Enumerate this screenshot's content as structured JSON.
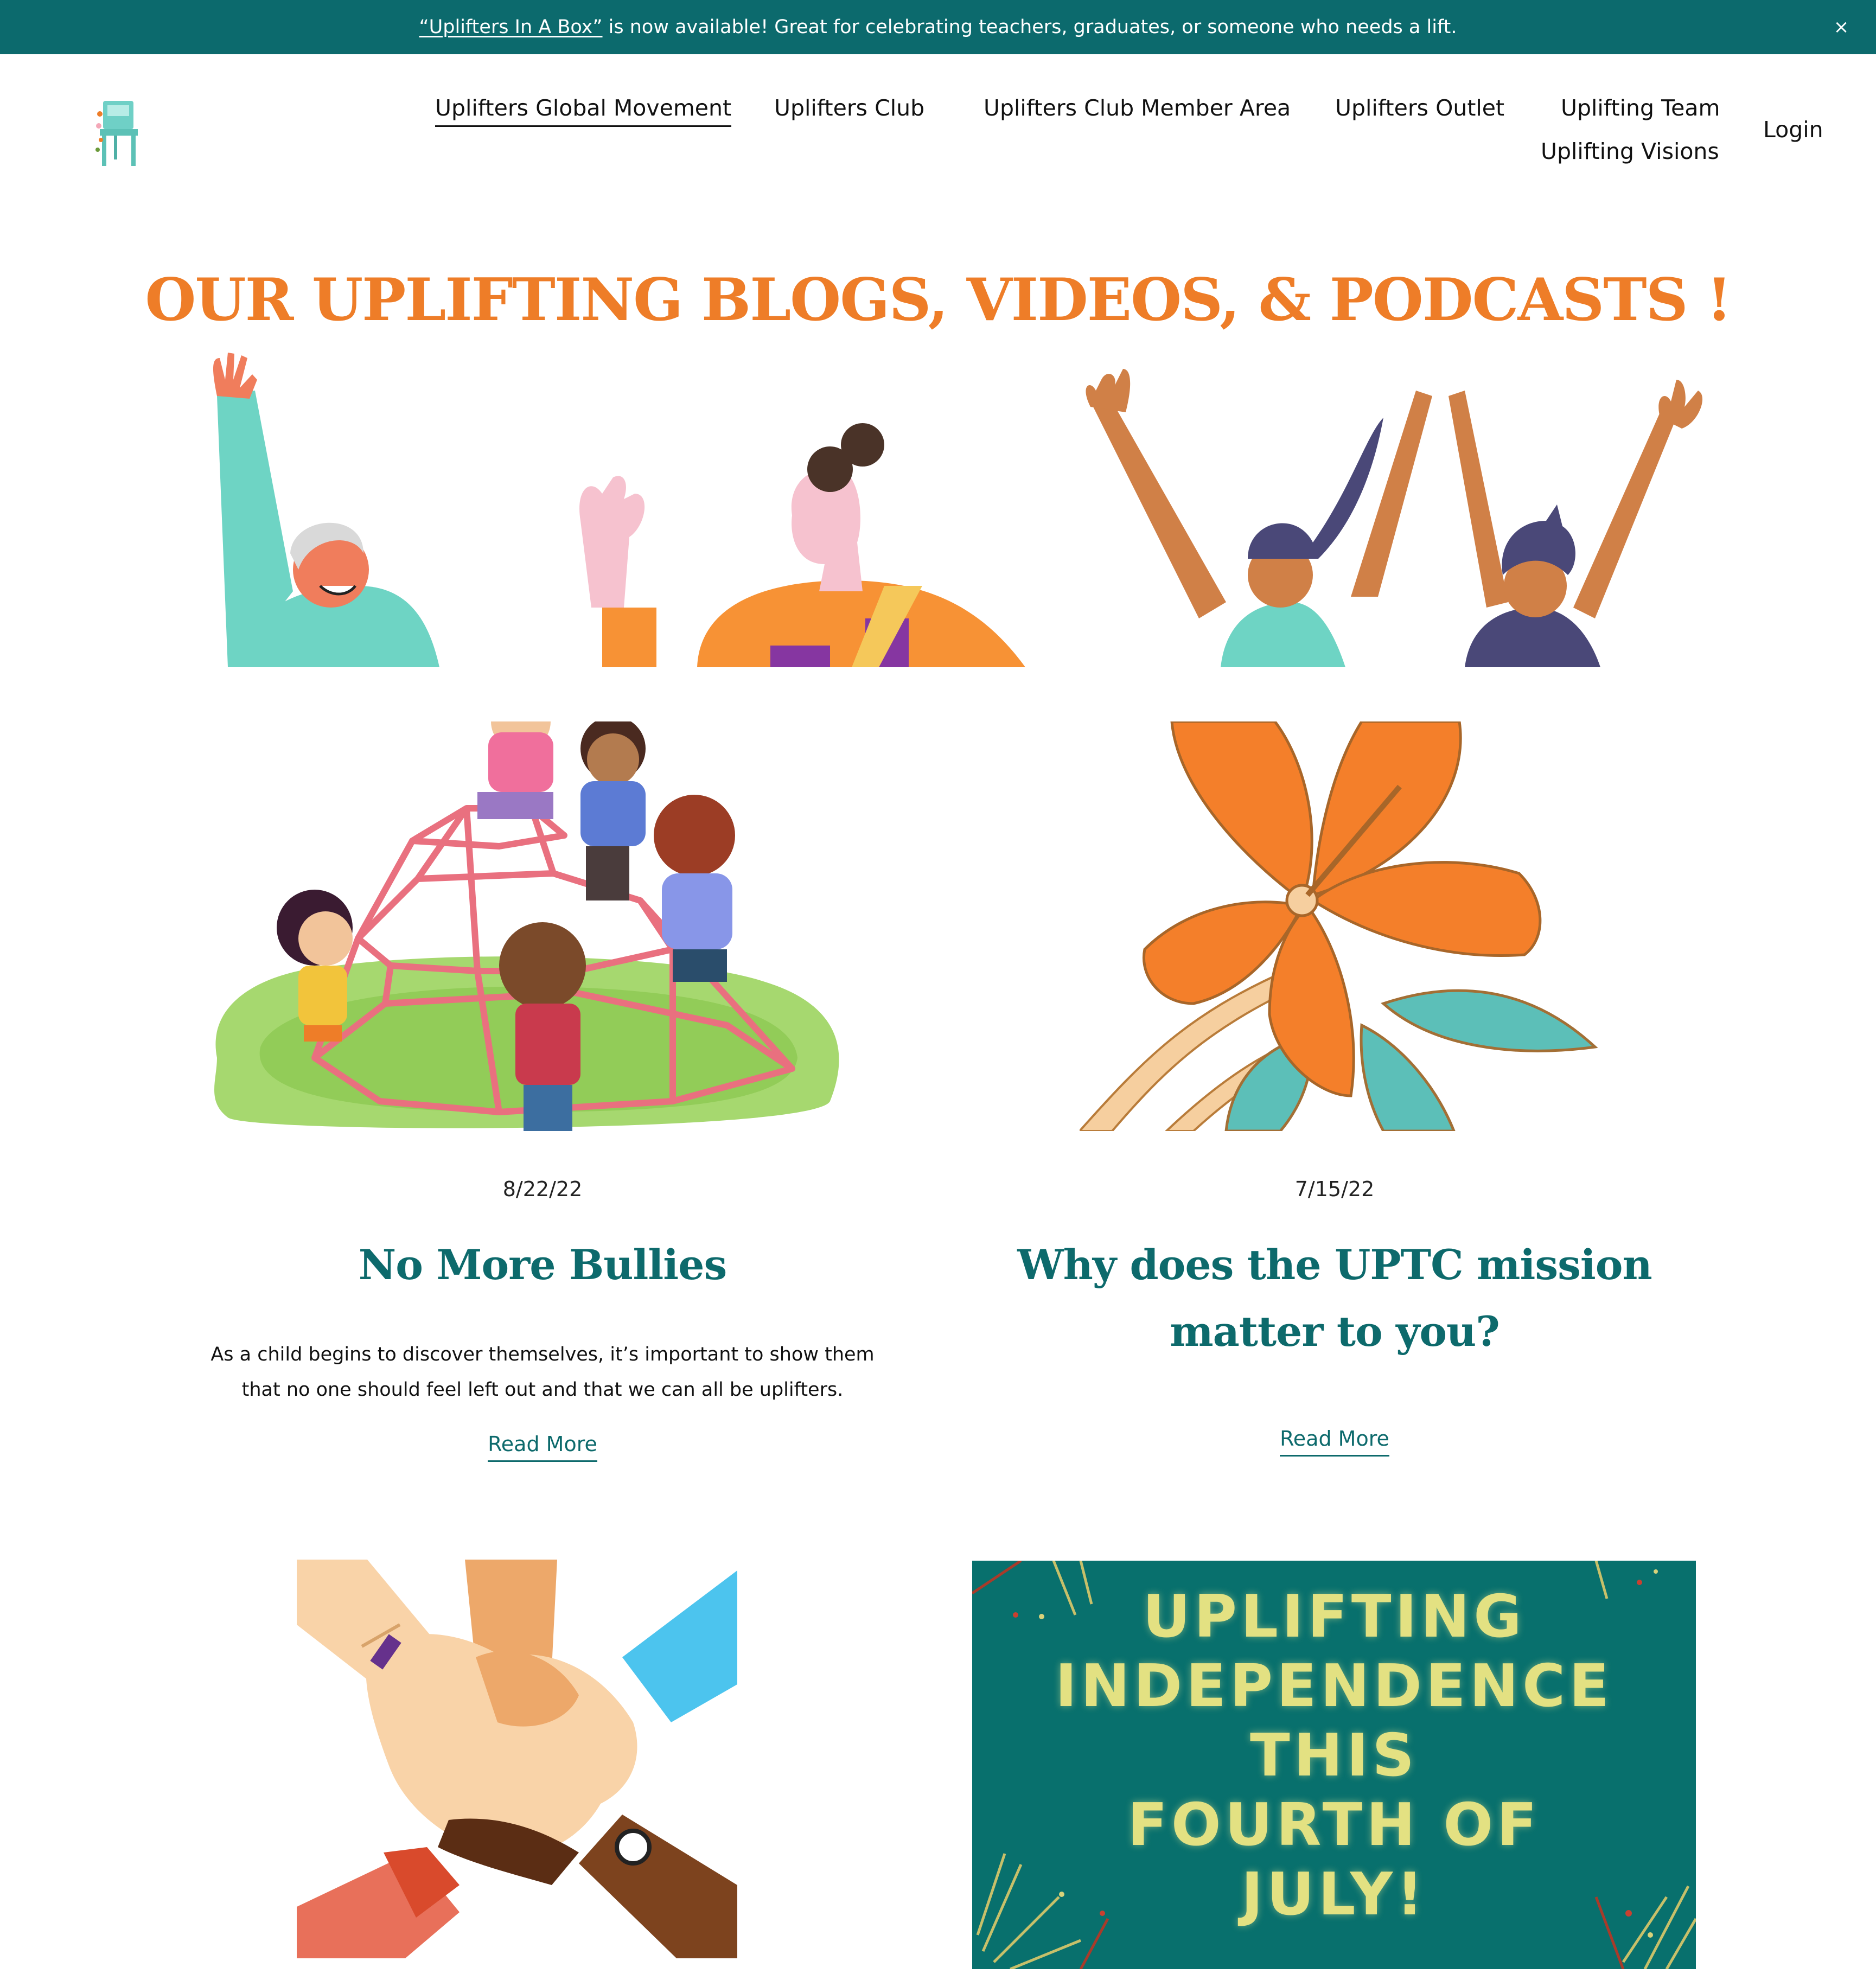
{
  "announcement": {
    "link_text": "“Uplifters In A Box”",
    "message": " is now available! Great for celebrating teachers, graduates, or someone who needs a lift.",
    "close_glyph": "×"
  },
  "header": {
    "logo_icon": "chair-logo-icon",
    "nav": [
      {
        "label": "Uplifters Global Movement",
        "active": true
      },
      {
        "label": "Uplifters Club"
      },
      {
        "label": "Uplifters Club Member Area"
      },
      {
        "label": "Uplifters Outlet"
      },
      {
        "label": "Uplifting Team"
      },
      {
        "label": "Uplifting Visions"
      }
    ],
    "login_label": "Login"
  },
  "page": {
    "headline": "OUR UPLIFTING BLOGS, VIDEOS, & PODCASTS !",
    "accent_color": "#ee7d28",
    "brand_color": "#0c6a6d"
  },
  "posts": [
    {
      "image": "children-playground-illustration",
      "date": "8/22/22",
      "title": "No More Bullies",
      "excerpt": "As a child begins to discover themselves, it’s important to show them that no one should feel left out and that we can all be uplifters.",
      "read_more": "Read More"
    },
    {
      "image": "orange-flower-illustration",
      "date": "7/15/22",
      "title": "Why does the UPTC mission matter to you?",
      "excerpt": "",
      "read_more": "Read More"
    },
    {
      "image": "stacked-hands-illustration"
    },
    {
      "image": "independence-day-graphic",
      "image_text_lines": [
        "UPLIFTING",
        "INDEPENDENCE",
        "THIS",
        "FOURTH OF",
        "JULY!"
      ]
    }
  ]
}
